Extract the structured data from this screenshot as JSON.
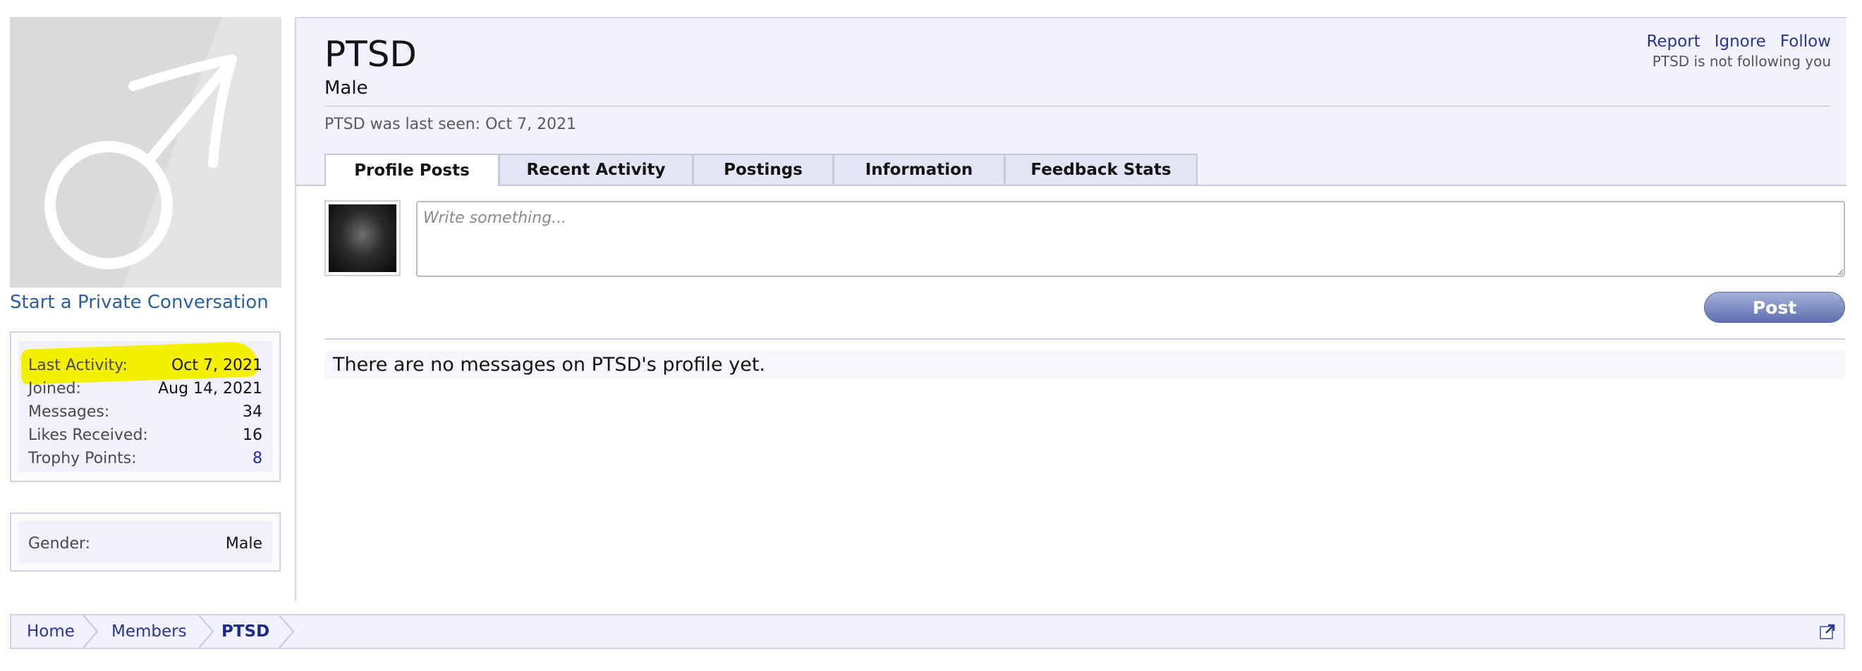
{
  "sidebar": {
    "avatar_icon": "male-symbol-icon",
    "start_conversation_label": "Start a Private Conversation",
    "stats": [
      {
        "label": "Last Activity:",
        "value": "Oct 7, 2021"
      },
      {
        "label": "Joined:",
        "value": "Aug 14, 2021"
      },
      {
        "label": "Messages:",
        "value": "34"
      },
      {
        "label": "Likes Received:",
        "value": "16"
      },
      {
        "label": "Trophy Points:",
        "value": "8"
      }
    ],
    "gender": {
      "label": "Gender:",
      "value": "Male"
    }
  },
  "profile": {
    "username": "PTSD",
    "subtitle": "Male",
    "last_seen": "PTSD was last seen: Oct 7, 2021",
    "links": {
      "report": "Report",
      "ignore": "Ignore",
      "follow": "Follow"
    },
    "follow_status": "PTSD is not following you"
  },
  "tabs": [
    {
      "label": "Profile Posts",
      "active": true
    },
    {
      "label": "Recent Activity",
      "active": false
    },
    {
      "label": "Postings",
      "active": false
    },
    {
      "label": "Information",
      "active": false
    },
    {
      "label": "Feedback Stats",
      "active": false
    }
  ],
  "compose": {
    "placeholder": "Write something...",
    "value": "",
    "post_label": "Post"
  },
  "messages": {
    "empty_text": "There are no messages on PTSD's profile yet."
  },
  "breadcrumb": {
    "items": [
      "Home",
      "Members",
      "PTSD"
    ],
    "popout_icon": "external-link-icon"
  },
  "colors": {
    "highlight": "#f5f000",
    "link": "#2a3590",
    "panel_bg": "#f1f2fd",
    "post_button": "#6f80b9"
  }
}
